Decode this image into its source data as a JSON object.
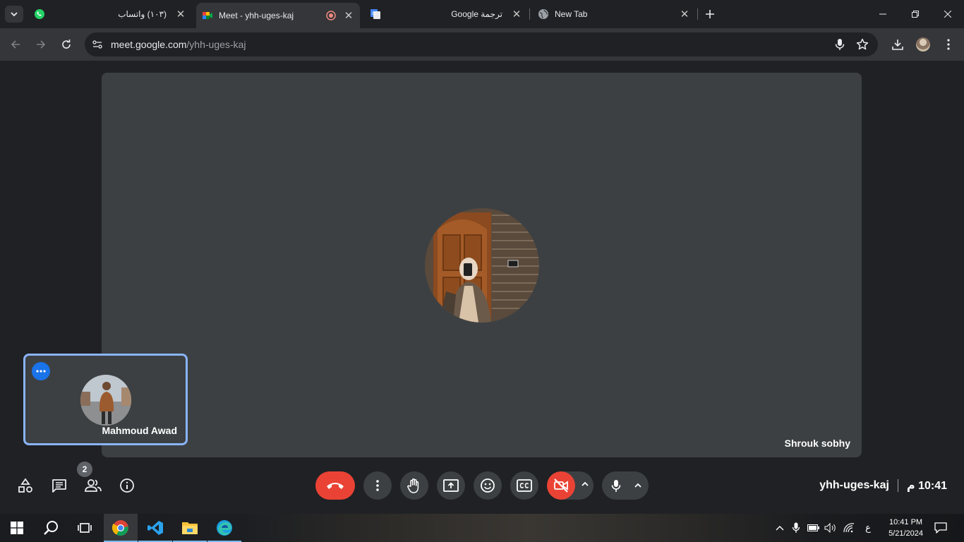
{
  "browser": {
    "tabs": [
      {
        "title": "(١٠٣) واتساب",
        "icon": "whatsapp-icon"
      },
      {
        "title": "Meet - yhh-uges-kaj",
        "icon": "google-meet-icon",
        "recording": true
      },
      {
        "title": "Google ترجمة",
        "icon": "google-translate-icon"
      },
      {
        "title": "New Tab",
        "icon": "globe-icon"
      }
    ],
    "url_host": "meet.google.com",
    "url_path": "/yhh-uges-kaj"
  },
  "meet": {
    "main_participant": "Shrouk sobhy",
    "self_participant": "Mahmoud Awad",
    "people_count": "2",
    "meeting_code": "yhh-uges-kaj",
    "time": "10:41 م",
    "colors": {
      "hangup": "#ea4335",
      "self_border": "#8ab4f8",
      "more_button": "#1a73e8",
      "tile": "#3c4043"
    }
  },
  "taskbar": {
    "lang": "ع",
    "time": "10:41 PM",
    "date": "5/21/2024"
  }
}
